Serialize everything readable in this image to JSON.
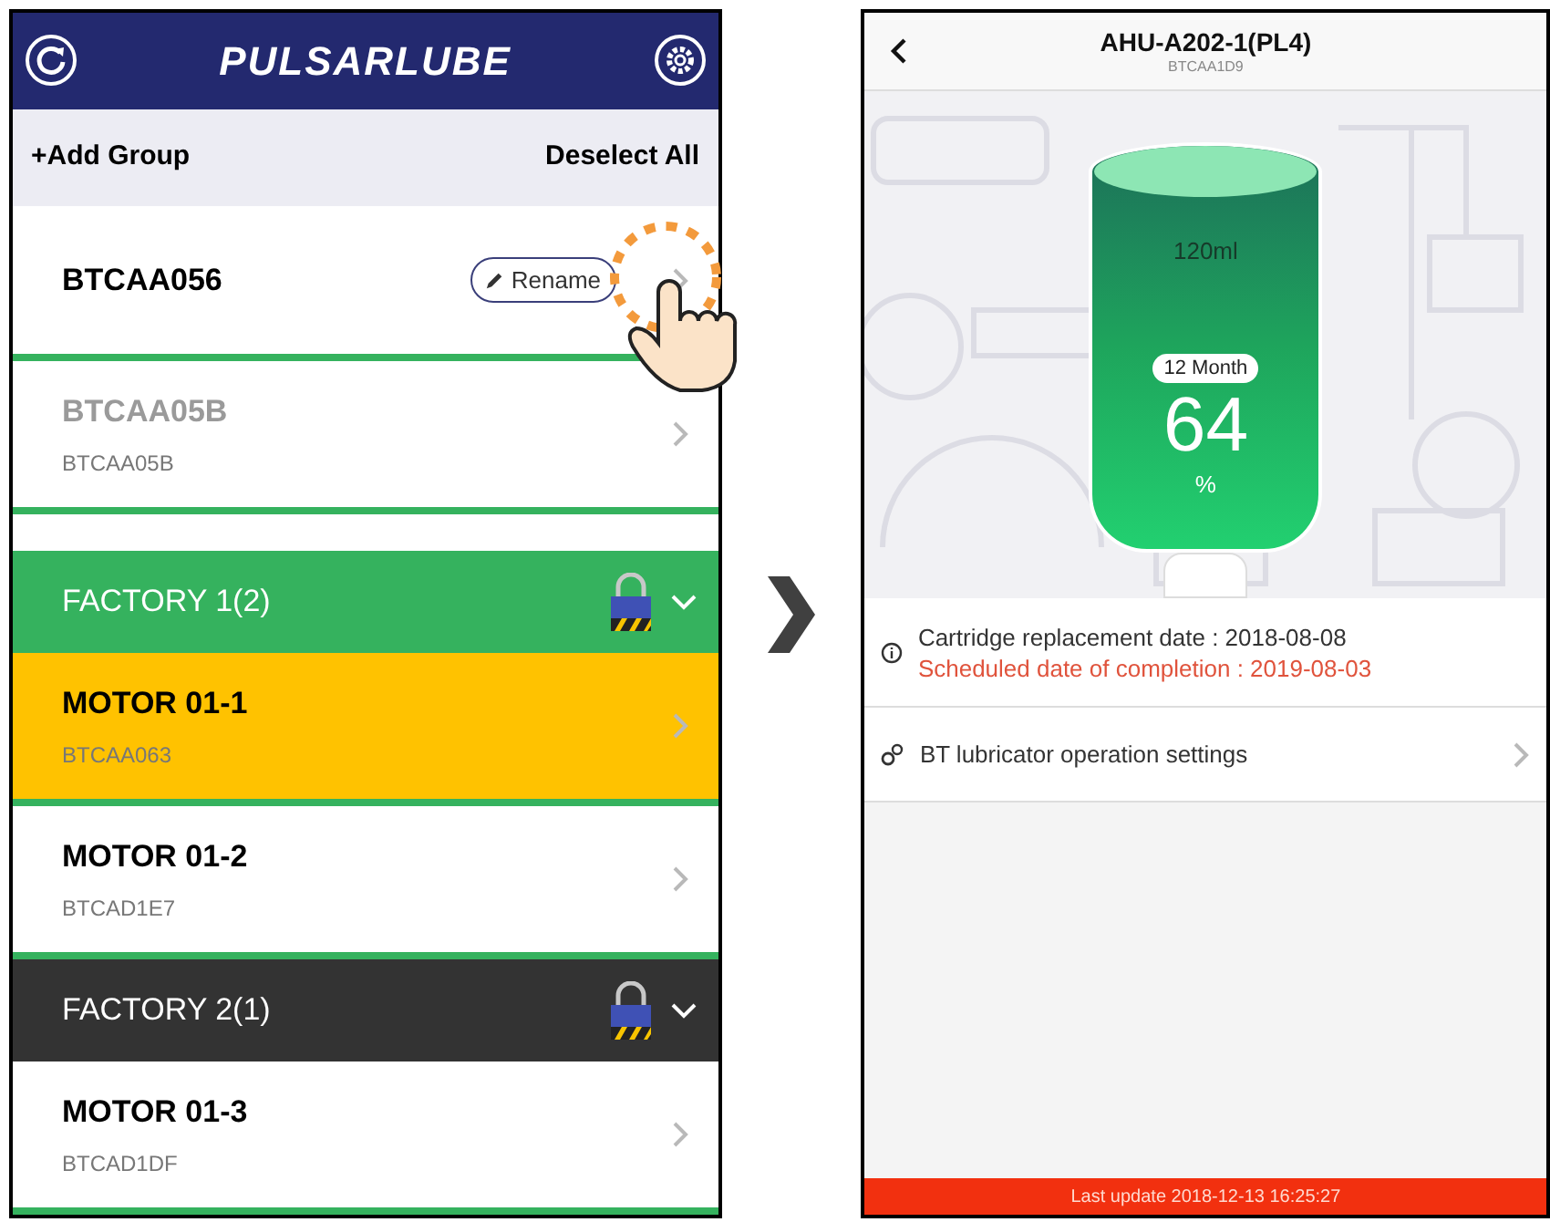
{
  "left_screen": {
    "logo": "PULSARLUBE",
    "toolbar": {
      "add_group": "+Add Group",
      "deselect_all": "Deselect All"
    },
    "devices": [
      {
        "name": "BTCAA056",
        "rename_label": "Rename",
        "selected": false,
        "disabled": false
      },
      {
        "name": "BTCAA05B",
        "id": "BTCAA05B",
        "selected": false,
        "disabled": true
      }
    ],
    "groups": [
      {
        "title": "FACTORY 1(2)",
        "color": "#35b25e",
        "expanded": true,
        "devices": [
          {
            "name": "MOTOR 01-1",
            "id": "BTCAA063",
            "selected": true,
            "disabled": false
          },
          {
            "name": "MOTOR 01-2",
            "id": "BTCAD1E7",
            "selected": false,
            "disabled": false
          }
        ]
      },
      {
        "title": "FACTORY 2(1)",
        "color": "#333333",
        "expanded": true,
        "devices": [
          {
            "name": "MOTOR 01-3",
            "id": "BTCAD1DF",
            "selected": false,
            "disabled": false
          }
        ]
      }
    ]
  },
  "right_screen": {
    "title": "AHU-A202-1(PL4)",
    "subtitle": "BTCAA1D9",
    "cartridge": {
      "volume": "120ml",
      "period": "12 Month",
      "remaining": "64",
      "unit": "%"
    },
    "info": {
      "replacement": "Cartridge replacement date : 2018-08-08",
      "completion": "Scheduled date of completion : 2019-08-03"
    },
    "settings_row": {
      "label": "BT lubricator operation settings"
    },
    "status_bar": "Last update 2018-12-13 16:25:27"
  }
}
